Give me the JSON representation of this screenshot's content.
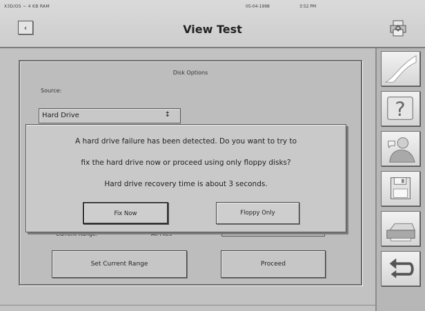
{
  "status_bar": {
    "left_text": "X3D/OS ~ 4 KB RAM",
    "date": "05-04-1998",
    "time": "3:52 PM"
  },
  "header": {
    "title": "View Test",
    "back_glyph": "‹"
  },
  "panel": {
    "title": "Disk Options",
    "source_label": "Source:",
    "source_value": "Hard Drive",
    "source_arrow": "↕",
    "range_label": "Current Range:",
    "range_value": "All Files",
    "set_range_button": "Set Current Range",
    "proceed_button": "Proceed"
  },
  "dialog": {
    "line1": "A hard drive failure has been detected. Do you want to try to",
    "line2": "fix the hard drive now or proceed using only floppy disks?",
    "line3": "Hard drive recovery time is about 3 seconds.",
    "fix_now_button": "Fix Now",
    "floppy_only_button": "Floppy Only"
  },
  "sidebar": {
    "icons": [
      "swoosh-icon",
      "help-icon",
      "user-help-icon",
      "floppy-disk-icon",
      "printer-icon",
      "return-icon"
    ]
  },
  "header_icon": "printer-gear-icon"
}
